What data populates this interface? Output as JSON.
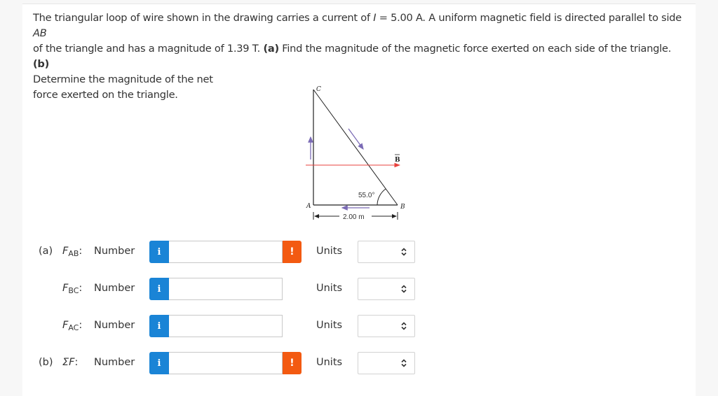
{
  "question": {
    "line1_pre": "The triangular loop of wire shown in the drawing carries a current of ",
    "current_symbol": "I",
    "line1_mid": " = 5.00 A. A uniform magnetic field is directed parallel to side ",
    "side_ab": "AB",
    "line2_pre": "of the triangle and has a magnitude of 1.39 T. ",
    "part_a_tag": "(a)",
    "line2_mid": " Find the magnitude of the magnetic force exerted on each side of the triangle. ",
    "part_b_tag": "(b)",
    "line3": "Determine the magnitude of the net",
    "line4": "force exerted on the triangle."
  },
  "diagram": {
    "vertex_a": "A",
    "vertex_b": "B",
    "vertex_c": "C",
    "field_label": "B",
    "angle_label": "55.0°",
    "length_label": "2.00 m",
    "field_color": "#e8413c",
    "current_arrow_color": "#7b6bb5"
  },
  "answers": [
    {
      "part": "(a)",
      "symbol": "F",
      "subscript": "AB",
      "input_label": "Number",
      "value": "",
      "has_warning": true,
      "units_label": "Units",
      "units_value": ""
    },
    {
      "part": "",
      "symbol": "F",
      "subscript": "BC",
      "input_label": "Number",
      "value": "",
      "has_warning": false,
      "units_label": "Units",
      "units_value": ""
    },
    {
      "part": "",
      "symbol": "F",
      "subscript": "AC",
      "input_label": "Number",
      "value": "",
      "has_warning": false,
      "units_label": "Units",
      "units_value": ""
    },
    {
      "part": "(b)",
      "symbol": "ΣF",
      "subscript": "",
      "input_label": "Number",
      "value": "",
      "has_warning": true,
      "units_label": "Units",
      "units_value": ""
    }
  ],
  "icons": {
    "info": "i",
    "warning": "!"
  },
  "colors": {
    "info_button": "#1a84d6",
    "warning_button": "#f35a11"
  }
}
